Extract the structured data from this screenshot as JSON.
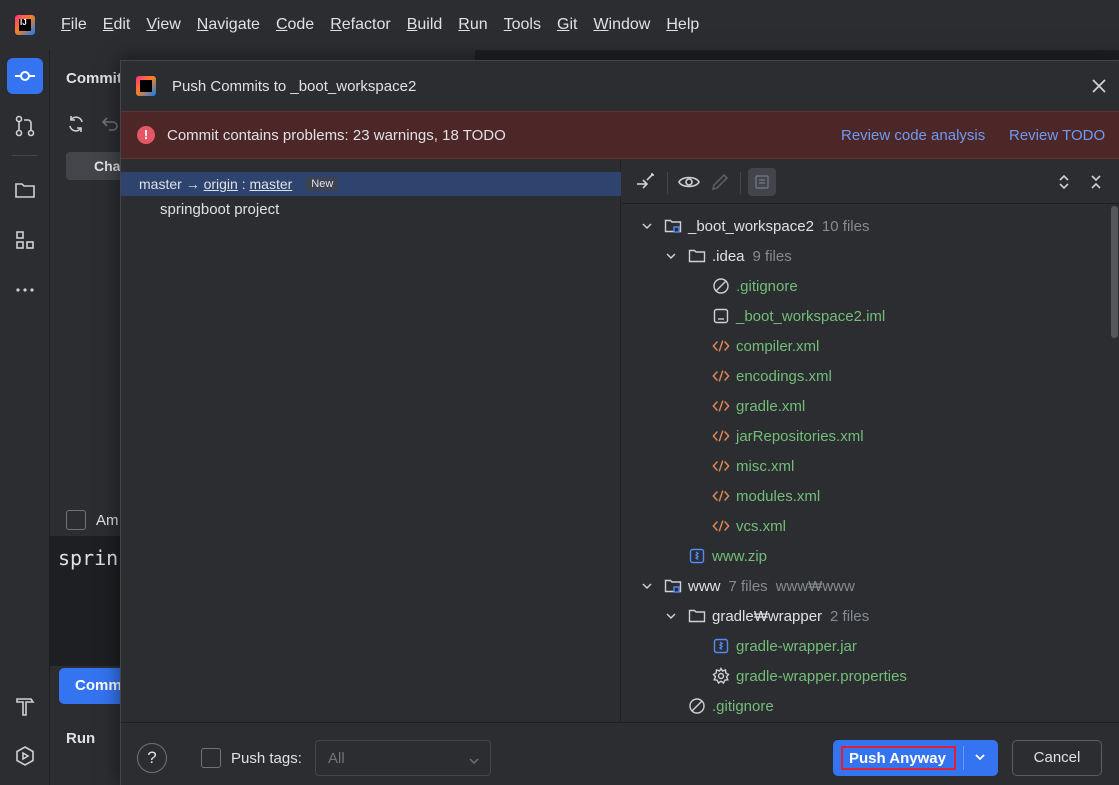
{
  "menu": {
    "items": [
      "File",
      "Edit",
      "View",
      "Navigate",
      "Code",
      "Refactor",
      "Build",
      "Run",
      "Tools",
      "Git",
      "Window",
      "Help"
    ]
  },
  "background_panel": {
    "title": "Commit",
    "tab_label": "Cha",
    "amend_label": "Am",
    "message_text": "sprin",
    "commit_button": "Comm",
    "run_label": "Run"
  },
  "dialog": {
    "title": "Push Commits to _boot_workspace2",
    "warning": {
      "text": "Commit contains problems: 23 warnings, 18 TODO",
      "link_review_code": "Review code analysis",
      "link_review_todo": "Review TODO"
    },
    "branch": {
      "local": "master",
      "arrow": "→",
      "remote": "origin",
      "colon": ":",
      "remote_branch": "master",
      "badge": "New"
    },
    "commit_message": "springboot project",
    "tree": [
      {
        "name": "_boot_workspace2",
        "count": "10 files",
        "type": "module",
        "indent": 0,
        "expanded": true,
        "color": "normal"
      },
      {
        "name": ".idea",
        "count": "9 files",
        "type": "folder",
        "indent": 1,
        "expanded": true,
        "color": "normal"
      },
      {
        "name": ".gitignore",
        "count": "",
        "type": "ignore",
        "indent": 2,
        "color": "green"
      },
      {
        "name": "_boot_workspace2.iml",
        "count": "",
        "type": "iml",
        "indent": 2,
        "color": "green"
      },
      {
        "name": "compiler.xml",
        "count": "",
        "type": "xml",
        "indent": 2,
        "color": "green"
      },
      {
        "name": "encodings.xml",
        "count": "",
        "type": "xml",
        "indent": 2,
        "color": "green"
      },
      {
        "name": "gradle.xml",
        "count": "",
        "type": "xml",
        "indent": 2,
        "color": "green"
      },
      {
        "name": "jarRepositories.xml",
        "count": "",
        "type": "xml",
        "indent": 2,
        "color": "green"
      },
      {
        "name": "misc.xml",
        "count": "",
        "type": "xml",
        "indent": 2,
        "color": "green"
      },
      {
        "name": "modules.xml",
        "count": "",
        "type": "xml",
        "indent": 2,
        "color": "green"
      },
      {
        "name": "vcs.xml",
        "count": "",
        "type": "xml",
        "indent": 2,
        "color": "green"
      },
      {
        "name": "www.zip",
        "count": "",
        "type": "zip",
        "indent": 1,
        "color": "green"
      },
      {
        "name": "www",
        "count": "7 files",
        "extra": "www₩www",
        "type": "module",
        "indent": 0,
        "expanded": true,
        "color": "normal"
      },
      {
        "name": "gradle₩wrapper",
        "count": "2 files",
        "type": "folder",
        "indent": 1,
        "expanded": true,
        "color": "normal"
      },
      {
        "name": "gradle-wrapper.jar",
        "count": "",
        "type": "zip",
        "indent": 2,
        "color": "green"
      },
      {
        "name": "gradle-wrapper.properties",
        "count": "",
        "type": "gear",
        "indent": 2,
        "color": "green"
      },
      {
        "name": ".gitignore",
        "count": "",
        "type": "ignore",
        "indent": 1,
        "color": "green"
      }
    ],
    "footer": {
      "help": "?",
      "push_tags_label": "Push tags:",
      "tags_select_value": "All",
      "push_button": "Push Anyway",
      "cancel_button": "Cancel"
    }
  },
  "colors": {
    "accent": "#3574f0",
    "warning_bg": "#4d2728",
    "link": "#6d9bf1",
    "added_file": "#73bd79",
    "highlight_border": "#e0202f"
  }
}
